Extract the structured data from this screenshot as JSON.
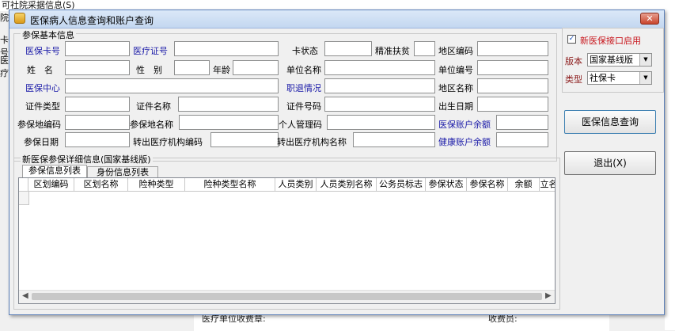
{
  "background": {
    "top_text": "可社院采据信息(S)",
    "left_texts": [
      "院",
      "卡号",
      "医疗"
    ],
    "bottom_left_text": "医疗单位收费章:",
    "bottom_right_text": "收费员:"
  },
  "window": {
    "title": "医保病人信息查询和账户查询",
    "close_label": "✕"
  },
  "basic_info": {
    "legend": "参保基本信息",
    "labels": {
      "card_no": "医保卡号",
      "med_cert_no": "医疗证号",
      "card_status": "卡状态",
      "poverty": "精准扶贫",
      "area_code": "地区编码",
      "name": "姓　名",
      "gender": "性　别",
      "age": "年龄",
      "unit_name": "单位名称",
      "unit_no": "单位编号",
      "insurance_center": "医保中心",
      "retire_status": "职退情况",
      "area_name": "地区名称",
      "cert_type": "证件类型",
      "cert_name": "证件名称",
      "cert_no": "证件号码",
      "birth_date": "出生日期",
      "insured_area_code": "参保地编码",
      "insured_area_name": "参保地名称",
      "personal_code": "个人管理码",
      "account_balance": "医保账户余额",
      "insured_date": "参保日期",
      "transfer_out_code": "转出医疗机构编码",
      "transfer_out_name": "转出医疗机构名称",
      "health_balance": "健康账户余额"
    }
  },
  "detail": {
    "legend": "新医保参保详细信息(国家基线版)",
    "tabs": [
      "参保信息列表",
      "身份信息列表"
    ],
    "columns": [
      "区划编码",
      "区划名称",
      "险种类型",
      "险种类型名称",
      "人员类别",
      "人员类别名称",
      "公务员标志",
      "参保状态",
      "参保名称",
      "余额",
      "立名"
    ]
  },
  "right_panel": {
    "enable_label": "新医保接口启用",
    "version_label": "版本",
    "version_value": "国家基线版",
    "type_label": "类型",
    "type_value": "社保卡",
    "query_button": "医保信息查询",
    "exit_button": "退出(X)"
  }
}
